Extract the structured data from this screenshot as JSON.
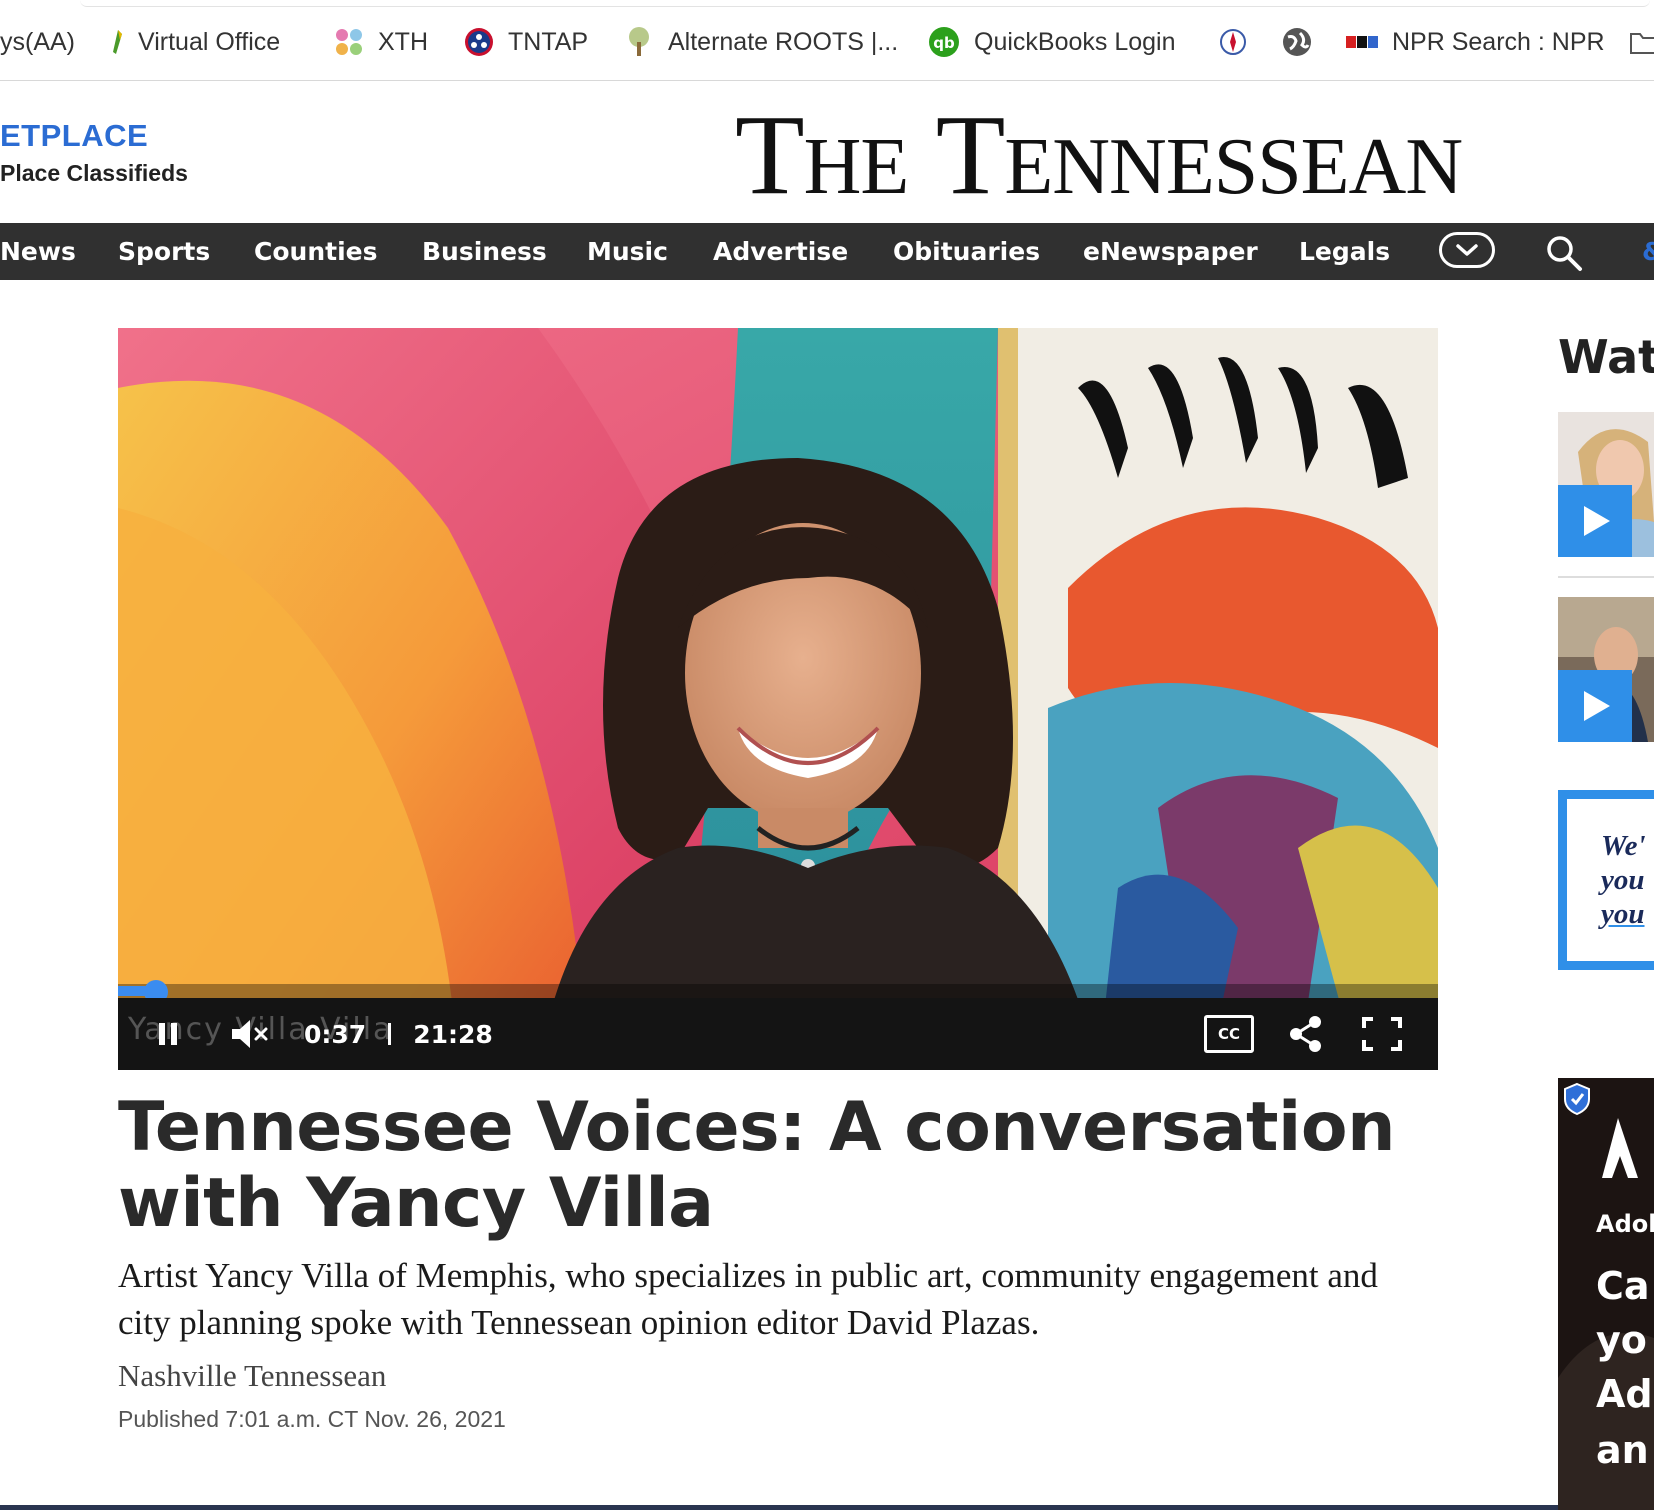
{
  "bookmarks": [
    {
      "label": "ys(AA)",
      "icon": "none"
    },
    {
      "label": "Virtual Office",
      "icon": "leaf-icon"
    },
    {
      "label": "XTH",
      "icon": "dots-icon"
    },
    {
      "label": "TNTAP",
      "icon": "tennessee-seal-icon"
    },
    {
      "label": "Alternate ROOTS |...",
      "icon": "tree-icon"
    },
    {
      "label": "QuickBooks Login",
      "icon": "quickbooks-icon"
    },
    {
      "label": "",
      "icon": "emblem-icon"
    },
    {
      "label": "",
      "icon": "globe-icon"
    },
    {
      "label": "NPR Search : NPR",
      "icon": "npr-icon"
    }
  ],
  "masthead": {
    "left_title": "ETPLACE",
    "left_subtitle": "Place Classifieds",
    "logo_the": "The",
    "logo_main": "Tennessean"
  },
  "nav": {
    "items": [
      "News",
      "Sports",
      "Counties",
      "Business",
      "Music",
      "Advertise",
      "Obituaries",
      "eNewspaper",
      "Legals"
    ],
    "edge_text": "&"
  },
  "video": {
    "overlay_text": "Yancy Villa Villa",
    "current_time": "0:37",
    "duration": "21:28",
    "progress_fraction": 0.029,
    "cc_label": "CC"
  },
  "article": {
    "headline": "Tennessee Voices: A conversation with Yancy Villa",
    "summary": "Artist Yancy Villa of Memphis, who specializes in public art, community engagement and city planning spoke with Tennessean opinion editor David Plazas.",
    "source": "Nashville Tennessean",
    "published": "Published 7:01 a.m. CT Nov. 26, 2021"
  },
  "rail": {
    "title": "Wat",
    "promo_lines": [
      "We'",
      "you",
      "you"
    ],
    "ad_lines": [
      "Adob",
      "Ca",
      "yo",
      "Ad",
      "an"
    ]
  },
  "colors": {
    "accent": "#2f8fe8",
    "nav_bg": "#303030",
    "progress": "#3a8cf0"
  }
}
